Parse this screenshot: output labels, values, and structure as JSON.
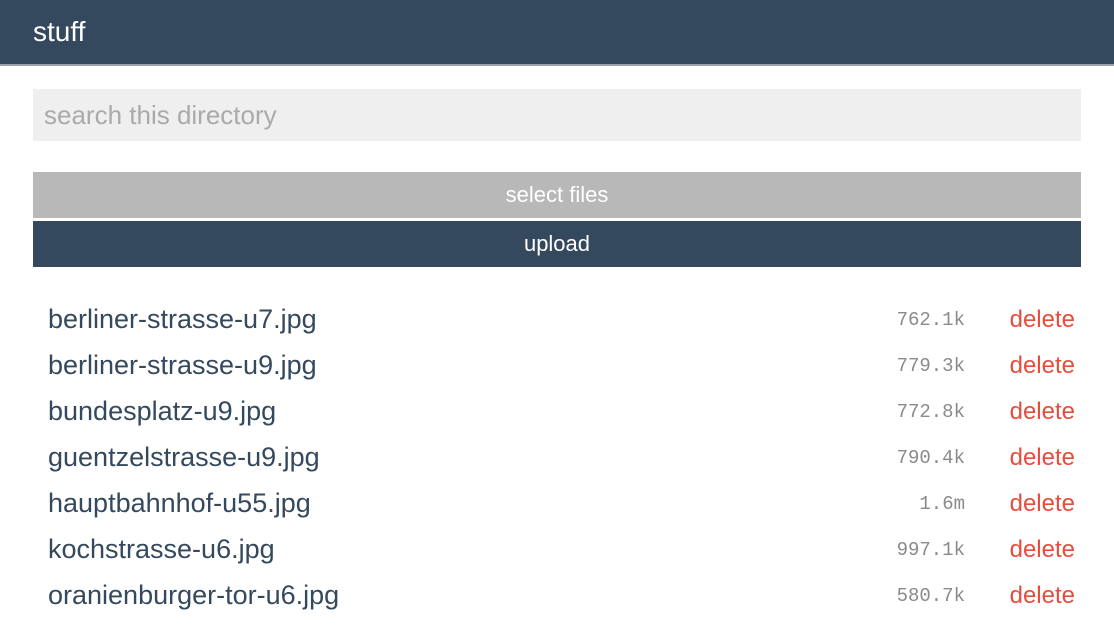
{
  "header": {
    "title": "stuff"
  },
  "search": {
    "placeholder": "search this directory",
    "value": ""
  },
  "actions": {
    "select_label": "select files",
    "upload_label": "upload"
  },
  "files": [
    {
      "name": "berliner-strasse-u7.jpg",
      "size": "762.1k",
      "delete_label": "delete"
    },
    {
      "name": "berliner-strasse-u9.jpg",
      "size": "779.3k",
      "delete_label": "delete"
    },
    {
      "name": "bundesplatz-u9.jpg",
      "size": "772.8k",
      "delete_label": "delete"
    },
    {
      "name": "guentzelstrasse-u9.jpg",
      "size": "790.4k",
      "delete_label": "delete"
    },
    {
      "name": "hauptbahnhof-u55.jpg",
      "size": "1.6m",
      "delete_label": "delete"
    },
    {
      "name": "kochstrasse-u6.jpg",
      "size": "997.1k",
      "delete_label": "delete"
    },
    {
      "name": "oranienburger-tor-u6.jpg",
      "size": "580.7k",
      "delete_label": "delete"
    }
  ],
  "colors": {
    "header_bg": "#34495e",
    "select_bg": "#b8b8b8",
    "upload_bg": "#34495e",
    "delete": "#e74c3c",
    "filename": "#34495e"
  }
}
